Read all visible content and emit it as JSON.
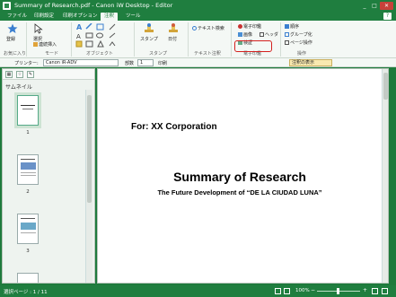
{
  "window": {
    "title": "Summary of Research.pdf - Canon iW Desktop - Editor",
    "minimize": "_",
    "maximize": "□",
    "close": "✕"
  },
  "menu": {
    "tabs": [
      "ファイル",
      "印刷設定",
      "印刷オプション",
      "注釈",
      "ツール"
    ],
    "active_index": 3,
    "help": "?"
  },
  "ribbon": {
    "favorite": "登録",
    "select_label": "選択",
    "link_register": "連続挿入",
    "stamp": "スタンプ",
    "date": "日付",
    "text_search": "テキスト検索",
    "sticky": "付箋",
    "image": "画像",
    "verify": "検証",
    "esign": "電子印鑑",
    "page_header": "ヘッダ",
    "order": "順序",
    "group": "グループ化",
    "page_op": "ページ操作",
    "groups": {
      "favorites": "お気に入り",
      "mode": "モード",
      "objects": "オブジェクト",
      "stamp": "スタンプ",
      "text_note": "テキスト注釈",
      "esign": "電子印鑑",
      "operation": "操作"
    }
  },
  "toolbar2": {
    "printer_label": "プリンター:",
    "printer_value": "Canon iR-ADV",
    "copies_label": "部数",
    "copies_value": "1",
    "print_label": "印刷",
    "notes_button": "注釈の表示"
  },
  "leftpane": {
    "title": "サムネイル",
    "thumbnails": [
      {
        "num": "1"
      },
      {
        "num": "2"
      },
      {
        "num": "3"
      }
    ]
  },
  "document": {
    "for_line": "For: XX Corporation",
    "title": "Summary of Research",
    "subtitle": "The Future Development of “DE LA CIUDAD LUNA”"
  },
  "status": {
    "page": "選択ページ : 1 / 11",
    "zoom": "100%"
  }
}
